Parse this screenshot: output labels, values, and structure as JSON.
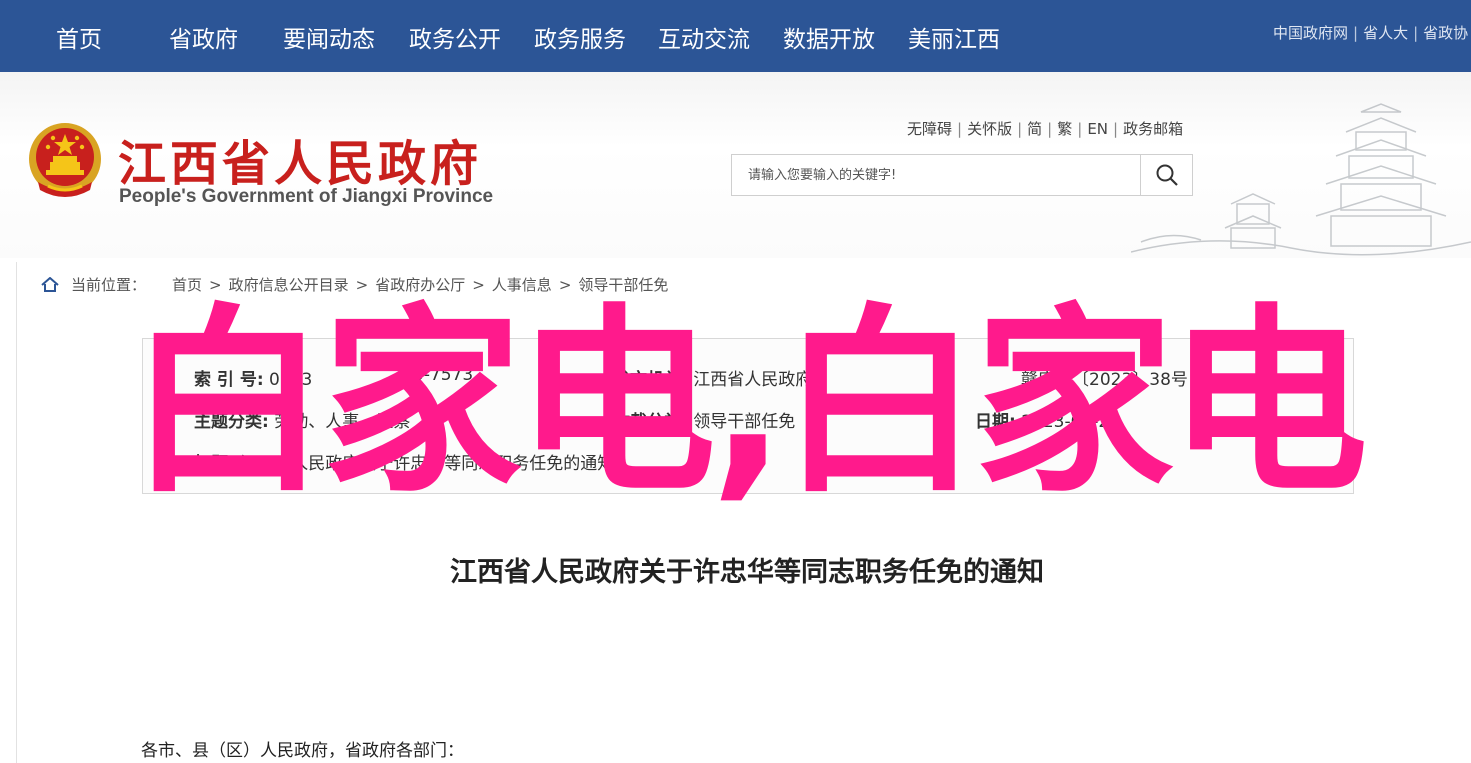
{
  "nav": {
    "items": [
      "首页",
      "省政府",
      "要闻动态",
      "政务公开",
      "政务服务",
      "互动交流",
      "数据开放",
      "美丽江西"
    ],
    "quick_links": [
      "中国政府网",
      "省人大",
      "省政协"
    ]
  },
  "header": {
    "title": "江西省人民政府",
    "subtitle": "People's Government of Jiangxi Province",
    "util_links": [
      "无障碍",
      "关怀版",
      "简",
      "繁",
      "EN",
      "政务邮箱"
    ],
    "search_placeholder": "请输入您要输入的关键字!"
  },
  "breadcrumb": {
    "label": "当前位置：",
    "items": [
      "首页",
      "政府信息公开目录",
      "省政府办公厅",
      "人事信息",
      "领导干部任免"
    ]
  },
  "meta": {
    "index_key": "索 引 号:",
    "index_val": "0143",
    "index_val_tail": "3-7573",
    "issuer_key": "发文机关:",
    "issuer_val": "江西省人民政府",
    "doc_no_tail": "赣府字〔2023〕38号",
    "topic_key": "主题分类:",
    "topic_val": "劳动、人事、监察",
    "system_key": "体裁分类:",
    "system_val": "领导干部任免",
    "date_key": "日期:",
    "date_val": "2023-04-28",
    "title_key": "标题:",
    "title_val": "江西省人民政府关于许忠华等同志职务任免的通知"
  },
  "watermark": "白家电,白家电",
  "article": {
    "title": "江西省人民政府关于许忠华等同志职务任免的通知",
    "salutation": "各市、县（区）人民政府，省政府各部门："
  },
  "colors": {
    "nav_bg": "#2c5596",
    "title_red": "#c8201d",
    "watermark_pink": "#ff1a8c"
  }
}
